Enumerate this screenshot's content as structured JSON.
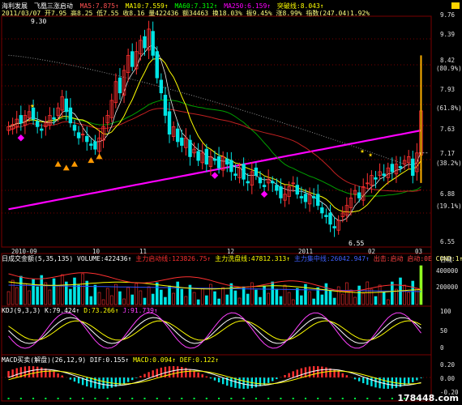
{
  "header": {
    "stock_name": "海利发展",
    "indicator": "飞凰三涨启动",
    "ma5": "MA5:7.875↑",
    "ma10": "MA10:7.559↑",
    "ma60": "MA60:7.312↑",
    "ma250": "MA250:6.159↑",
    "breakout": "突破线:8.043↑",
    "row2": "2011/03/07  开7.95  高8.25 低7.55  收8.16  量422436  额34463  换18.03%  振9.45%  涨8.99%  指数(247.04)1.92%",
    "price_top": "9.30"
  },
  "price_axis": [
    {
      "label": "8.42",
      "pct": ""
    },
    {
      "label": "7.93",
      "pct": "(80.9%)"
    },
    {
      "label": "7.63",
      "pct": "(61.8%)"
    },
    {
      "label": "7.17",
      "pct": "(38.2%)"
    },
    {
      "label": "6.88",
      "pct": "(19.1%)"
    },
    {
      "label": "6.55",
      "pct": ""
    }
  ],
  "price_right_labels": [
    "9.76",
    "9.39",
    "8.42",
    "7.93",
    "7.63",
    "7.17",
    "6.88"
  ],
  "low_label": "6.55",
  "date_axis": [
    "2010-09",
    "10",
    "11",
    "12",
    "2011",
    "02",
    "03"
  ],
  "volume_panel": {
    "title": "日成交金额(5,35,135)",
    "volume": "VOLUME:422436↑",
    "main_in": "主力启动线:123826.75↑",
    "main_wash": "主力洗盘线:47812.313↑",
    "blue_line": "主力集中线:26042.947↑",
    "out": "出击:启动",
    "cond": "启动:0E",
    "cond2": "COND:1↑",
    "unit": "日线",
    "axis": [
      "400000",
      "200000"
    ]
  },
  "kdj_panel": {
    "title": "KDJ(9,3,3)",
    "k": "K:79.424↑",
    "d": "D:73.266↑",
    "j": "J:91.739↑",
    "axis": [
      "100",
      "50",
      "0"
    ]
  },
  "macd_panel": {
    "title": "MACD买卖(解盘)(26,12,9)",
    "dif": "DIF:0.155↑",
    "macd": "MACD:0.094↑",
    "dea": "DEF:0.122↑",
    "axis": [
      "0.20",
      "0.00",
      "-0.20"
    ]
  },
  "watermark": "178448.com",
  "colors": {
    "up": "#ff3030",
    "down": "#00e5e5",
    "ma250": "#ff00ff",
    "ma60": "#00c000",
    "ma10": "#ffff00",
    "ma5": "#ffffff",
    "grid": "#7a0000"
  },
  "chart_data": {
    "type": "candlestick",
    "title": "",
    "xlabel": "",
    "ylabel": "",
    "ylim": [
      6.4,
      9.4
    ],
    "close": [
      7.95,
      7.98,
      8.05,
      8.0,
      8.1,
      8.15,
      8.05,
      7.95,
      7.9,
      8.0,
      8.1,
      8.05,
      8.2,
      8.35,
      8.15,
      8.0,
      7.9,
      7.8,
      7.85,
      7.75,
      7.7,
      7.65,
      7.8,
      7.95,
      8.1,
      8.3,
      8.55,
      8.4,
      8.7,
      8.9,
      8.75,
      8.95,
      9.1,
      9.0,
      9.25,
      8.9,
      8.6,
      8.4,
      8.1,
      7.85,
      7.95,
      7.75,
      7.7,
      7.8,
      7.55,
      7.65,
      7.5,
      7.6,
      7.45,
      7.55,
      7.5,
      7.4,
      7.55,
      7.45,
      7.35,
      7.3,
      7.4,
      7.25,
      7.2,
      7.35,
      7.3,
      7.2,
      7.15,
      7.25,
      7.2,
      7.1,
      7.0,
      7.05,
      7.15,
      7.2,
      7.05,
      7.0,
      6.95,
      7.05,
      7.0,
      6.9,
      6.8,
      6.75,
      6.65,
      6.6,
      6.7,
      6.8,
      6.9,
      7.0,
      7.1,
      7.0,
      7.15,
      7.2,
      7.3,
      7.25,
      7.35,
      7.3,
      7.4,
      7.35,
      7.45,
      7.4,
      7.5,
      7.55,
      7.3,
      7.6,
      8.16
    ]
  }
}
